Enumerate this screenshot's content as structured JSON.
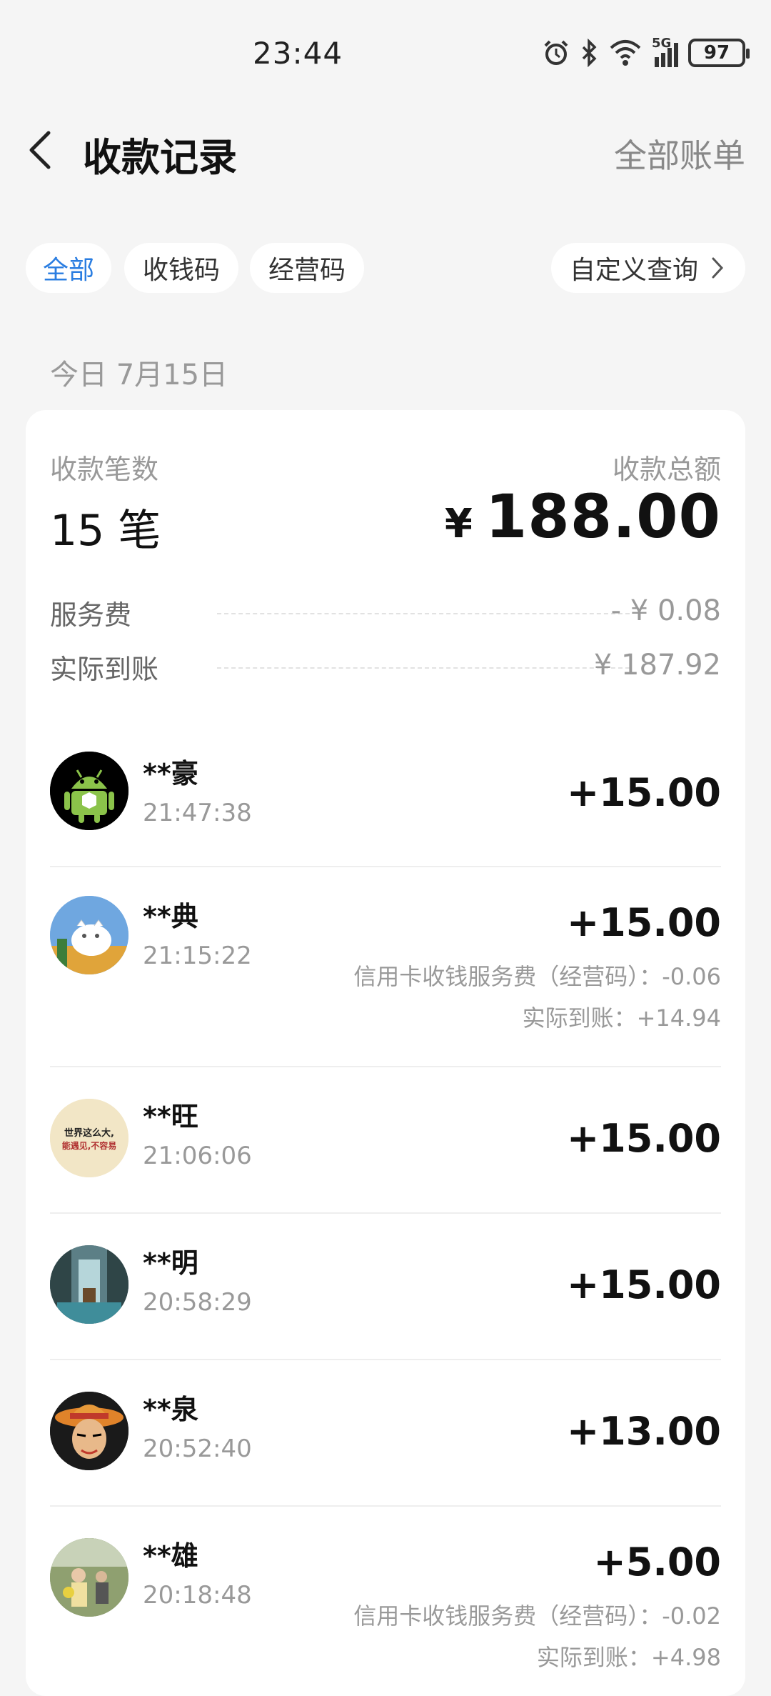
{
  "status_bar": {
    "time": "23:44",
    "network": "5G",
    "battery": "97",
    "icons": [
      "alarm-icon",
      "bluetooth-icon",
      "wifi-icon",
      "signal-icon",
      "battery-icon"
    ]
  },
  "header": {
    "title": "收款记录",
    "right_link": "全部账单",
    "back_icon": "chevron-left-icon"
  },
  "filters": {
    "chips": [
      "全部",
      "收钱码",
      "经营码"
    ],
    "active": "全部",
    "custom_query": "自定义查询"
  },
  "date_label": "今日 7月15日",
  "summary": {
    "count_label": "收款笔数",
    "count_value": "15 笔",
    "total_label": "收款总额",
    "currency": "¥",
    "total_value": "188.00",
    "service_fee_label": "服务费",
    "service_fee_value": "- ¥ 0.08",
    "actual_label": "实际到账",
    "actual_value": "¥ 187.92"
  },
  "transactions": [
    {
      "name": "**豪",
      "time": "21:47:38",
      "amount": "+15.00",
      "fee_note": "",
      "actual_note": ""
    },
    {
      "name": "**典",
      "time": "21:15:22",
      "amount": "+15.00",
      "fee_note": "信用卡收钱服务费（经营码）：-0.06",
      "actual_note": "实际到账：+14.94"
    },
    {
      "name": "**旺",
      "time": "21:06:06",
      "amount": "+15.00",
      "fee_note": "",
      "actual_note": ""
    },
    {
      "name": "**明",
      "time": "20:58:29",
      "amount": "+15.00",
      "fee_note": "",
      "actual_note": ""
    },
    {
      "name": "**泉",
      "time": "20:52:40",
      "amount": "+13.00",
      "fee_note": "",
      "actual_note": ""
    },
    {
      "name": "**雄",
      "time": "20:18:48",
      "amount": "+5.00",
      "fee_note": "信用卡收钱服务费（经营码）：-0.02",
      "actual_note": "实际到账：+4.98"
    }
  ],
  "avatar_texts": {
    "wang_line1": "世界这么大,",
    "wang_line2": "能遇见,不容易"
  },
  "colors": {
    "accent": "#2a7de1",
    "background": "#f5f5f5",
    "card": "#ffffff",
    "muted": "#999999"
  }
}
